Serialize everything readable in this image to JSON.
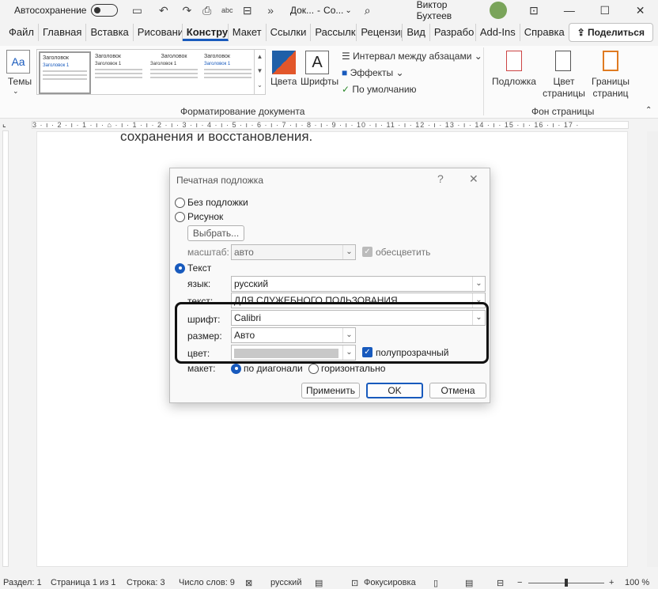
{
  "titlebar": {
    "autosave_label": "Автосохранение",
    "doc_name": "Док...",
    "separator": "-",
    "doc_status": "Со...",
    "user": "Виктор Бухтеев",
    "icons": [
      "save-icon",
      "undo-icon",
      "redo-icon",
      "more-icon"
    ]
  },
  "tabs": [
    "Файл",
    "Главная",
    "Вставка",
    "Рисовани",
    "Констру",
    "Макет",
    "Ссылки",
    "Рассылк",
    "Рецензир",
    "Вид",
    "Разрабо",
    "Add-Ins",
    "Справка"
  ],
  "active_tab": "Констру",
  "share_label": "Поделиться",
  "ribbon": {
    "themes_label": "Темы",
    "styles": [
      {
        "heading": "Заголовок",
        "sub": "Заголовок 1"
      },
      {
        "heading": "Заголовок",
        "sub": "Заголовок 1"
      },
      {
        "heading": "Заголовок",
        "sub": "Заголовок 1"
      },
      {
        "heading": "Заголовок",
        "sub": "Заголовок 1"
      }
    ],
    "colors_label": "Цвета",
    "fonts_label": "Шрифты",
    "paragraph_spacing": "Интервал между абзацами",
    "effects": "Эффекты",
    "set_default": "По умолчанию",
    "group_format": "Форматирование документа",
    "watermark_label": "Подложка",
    "page_color_label": "Цвет страницы",
    "page_borders_label": "Границы страниц",
    "group_background": "Фон страницы"
  },
  "ruler_text": "3 · ı · 2 · ı · 1 · ı · ⌂ · ı · 1 · ı · 2 · ı · 3 · ı · 4 · ı · 5 · ı · 6 · ı · 7 · ı · 8 · ı · 9 · ı · 10 · ı · 11 · ı · 12 · ı · 13 · ı · 14 · ı · 15 · ı · 16 · ı · 17 ·",
  "document_text": "сохранения и восстановления.",
  "dialog": {
    "title": "Печатная подложка",
    "help": "?",
    "close": "✕",
    "no_watermark": "Без подложки",
    "picture": "Рисунок",
    "choose_button": "Выбрать...",
    "scale_label": "масштаб:",
    "scale_value": "авто",
    "washout_label": "обесцветить",
    "text_option": "Текст",
    "language_label": "язык:",
    "language_value": "русский",
    "text_label": "текст:",
    "text_value": "ДЛЯ СЛУЖЕБНОГО ПОЛЬЗОВАНИЯ",
    "font_label": "шрифт:",
    "font_value": "Calibri",
    "size_label": "размер:",
    "size_value": "Авто",
    "color_label": "цвет:",
    "semitransparent_label": "полупрозрачный",
    "layout_label": "макет:",
    "diagonal_label": "по диагонали",
    "horizontal_label": "горизонтально",
    "apply_button": "Применить",
    "ok_button": "OK",
    "cancel_button": "Отмена"
  },
  "status": {
    "section": "Раздел: 1",
    "page": "Страница 1 из 1",
    "line": "Строка: 3",
    "words": "Число слов: 9",
    "language": "русский",
    "focus": "Фокусировка",
    "zoom": "100 %"
  }
}
